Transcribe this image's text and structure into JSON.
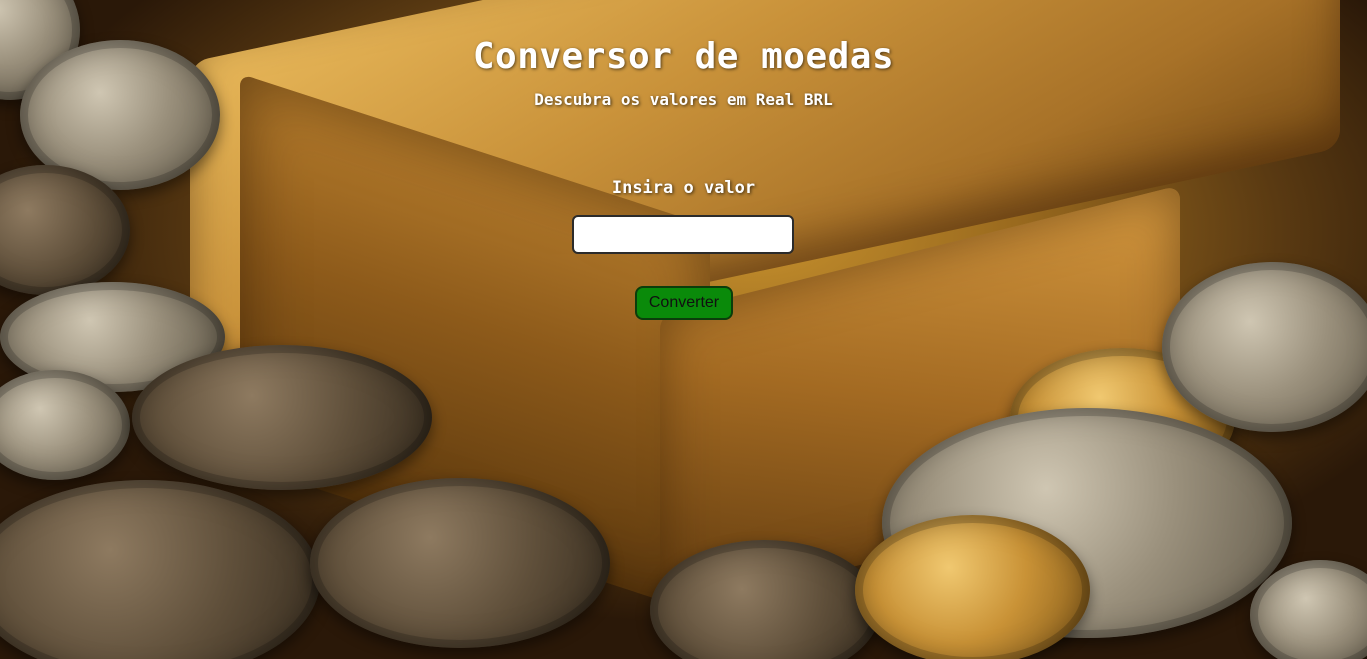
{
  "header": {
    "title": "Conversor de moedas",
    "subtitle": "Descubra os valores em Real BRL"
  },
  "form": {
    "input_label": "Insira o valor",
    "input_value": "",
    "input_placeholder": "",
    "button_label": "Converter"
  },
  "colors": {
    "button_background": "#0a8a0a",
    "text": "#ffffff"
  },
  "background": {
    "image_description_icon": "gold-bar-and-coins-image"
  }
}
